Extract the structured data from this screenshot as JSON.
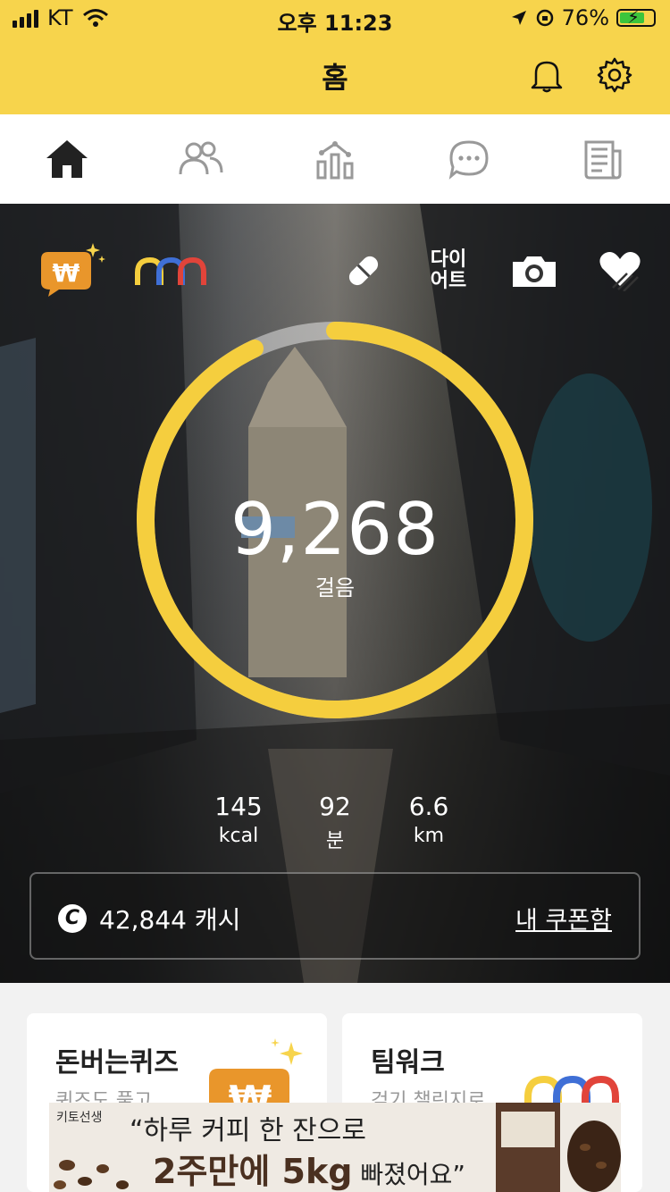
{
  "status_bar": {
    "carrier": "KT",
    "time": "오후 11:23",
    "battery_percent": "76%",
    "battery_level": 0.76
  },
  "header": {
    "title": "홈"
  },
  "nav": {
    "tabs": [
      "home-icon",
      "friends-icon",
      "stats-icon",
      "chat-icon",
      "news-icon"
    ],
    "active": "home-icon"
  },
  "hero": {
    "diet_label_line1": "다이",
    "diet_label_line2": "어트",
    "steps": "9,268",
    "steps_unit": "걸음",
    "goal_progress": 0.93,
    "stats": [
      {
        "value": "145",
        "unit": "kcal"
      },
      {
        "value": "92",
        "unit": "분"
      },
      {
        "value": "6.6",
        "unit": "km"
      }
    ],
    "cash_amount": "42,844 캐시",
    "coupon_link": "내 쿠폰함"
  },
  "cards": [
    {
      "title": "돈버는퀴즈",
      "subtitle": "퀴즈도 풀고"
    },
    {
      "title": "팀워크",
      "subtitle": "걷기 챌린지로"
    }
  ],
  "ad": {
    "brand": "키토선생",
    "line1": "“하루 커피 한 잔으로",
    "line2_bold": "2주만에 5kg",
    "line2_rest": " 빠졌어요”"
  },
  "colors": {
    "accent_yellow": "#f7d44c",
    "ring_yellow": "#f5ce3e",
    "wallet_orange": "#e9962b"
  }
}
